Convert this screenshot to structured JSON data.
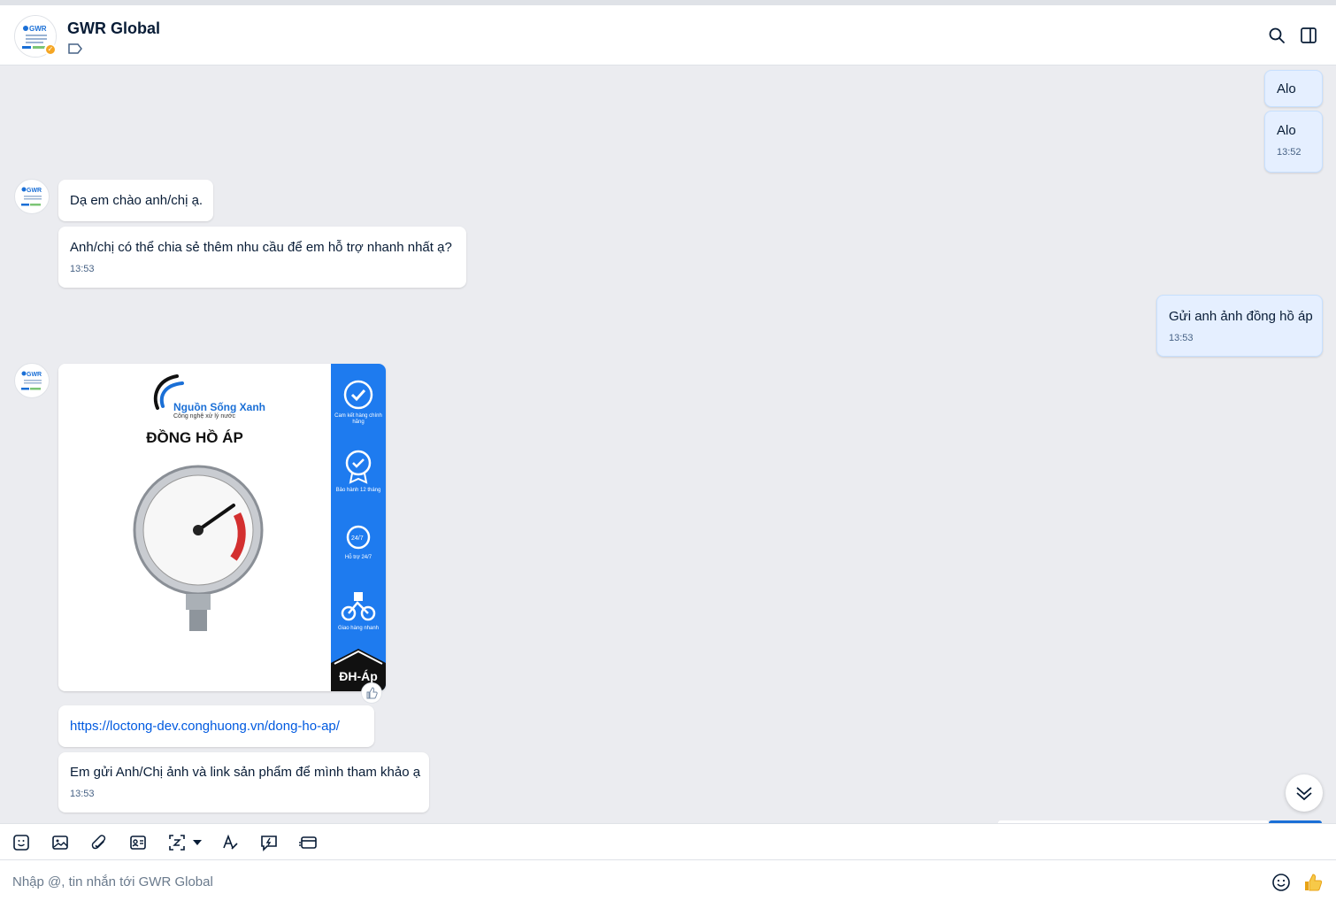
{
  "header": {
    "title": "GWR Global",
    "avatar_text": "GWR"
  },
  "messages": {
    "out_1": {
      "text": "Alo"
    },
    "out_2": {
      "text": "Alo",
      "time": "13:52"
    },
    "in_1": {
      "text": "Dạ em chào anh/chị ạ."
    },
    "in_2": {
      "text": "Anh/chị có thể chia sẻ thêm nhu cầu để em hỗ trợ nhanh nhất ạ?",
      "time": "13:53"
    },
    "out_3": {
      "text": "Gửi anh ảnh đồng hồ áp",
      "time": "13:53"
    },
    "image": {
      "brand": "Nguồn Sống Xanh",
      "brand_sub": "Công nghệ xử lý nước",
      "product": "ĐỒNG HỒ ÁP",
      "badges": [
        "Cam kết hàng chính hãng",
        "Bảo hành 12 tháng",
        "Hỗ trợ 24/7",
        "Giao hàng nhanh"
      ],
      "badge_247": "24/7",
      "code": "ĐH-Áp"
    },
    "in_link": {
      "text": "https://loctong-dev.conghuong.vn/dong-ho-ap/"
    },
    "in_3": {
      "text": "Em gửi Anh/Chị ảnh và link sản phẩm để mình tham khảo ạ",
      "time": "13:53"
    }
  },
  "composer": {
    "placeholder": "Nhập @, tin nhắn tới GWR Global"
  },
  "colors": {
    "accent": "#005ae0",
    "outgoing_bubble": "#e5efff",
    "chat_bg": "#ebecf0",
    "banner_blue": "#1e7bef"
  }
}
